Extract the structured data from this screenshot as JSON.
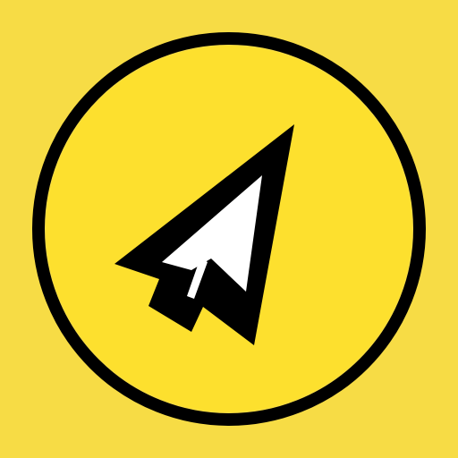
{
  "icon": {
    "name": "cursor-arrow-icon",
    "background_color": "#f7dc45",
    "ring_color": "#000000",
    "fill_color": "#fde02e",
    "arrow_color": "#ffffff",
    "outline_color": "#000000"
  }
}
